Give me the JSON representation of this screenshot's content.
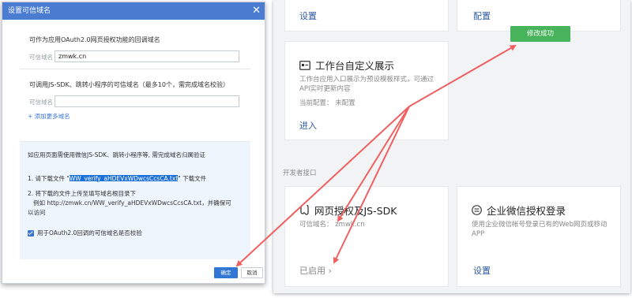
{
  "dialog": {
    "title": "设置可信域名",
    "close_glyph": "✕",
    "oauth_section": {
      "title": "可作为应用OAuth2.0网页授权功能的回调域名",
      "field_label": "可信域名",
      "field_value": "zmwk.cn"
    },
    "jssdk_section": {
      "title": "可调用JS-SDK、跳转小程序的可信域名（最多10个，需完成域名校验）",
      "field_label": "可信域名",
      "field_value": "",
      "add_more": "+ 添加更多域名"
    },
    "verify_section": {
      "title": "如应用页面需使用微信JS-SDK、跳转小程序等, 需完成域名归属验证",
      "step1_prefix": "1. 请下载文件 \"",
      "step1_file": "WW_verify_aHDEVxWDwcsCcsCA.txt",
      "step1_suffix": "\" 下载文件",
      "step2_line1": "2. 将下载的文件上传至填写域名根目录下",
      "step2_line2": "例如 http://zmwk.cn/WW_verify_aHDEVxWDwcsCcsCA.txt，并确保可",
      "step2_line3": "以访问",
      "checkbox_label": "用于OAuth2.0回调的可信域名是否校验",
      "checkbox_checked": true
    },
    "ok_label": "确定",
    "cancel_label": "取消"
  },
  "panel": {
    "top_card_left_link": "设置",
    "top_card_right_link": "配置",
    "toast": "修改成功",
    "workbench": {
      "title": "工作台自定义展示",
      "desc": "工作台应用入口展示为预设模板样式，可通过API实时更新内容",
      "current_config": "当前配置：  未配置",
      "link": "进入"
    },
    "section_label": "开发者接口",
    "web_auth": {
      "title": "网页授权及JS-SDK",
      "domain_line": "可信域名：  zmwk.cn",
      "status_link": "已启用 ›"
    },
    "ent_auth": {
      "title": "企业微信授权登录",
      "desc": "使用企业微信帐号登录已有的Web网页或移动APP",
      "link": "设置"
    }
  },
  "colors": {
    "titlebar": "#4a7dd2",
    "primary_button": "#3377d6",
    "toast": "#47b35a",
    "annotation_arrow": "#f06060",
    "link": "#2c5aa0"
  }
}
